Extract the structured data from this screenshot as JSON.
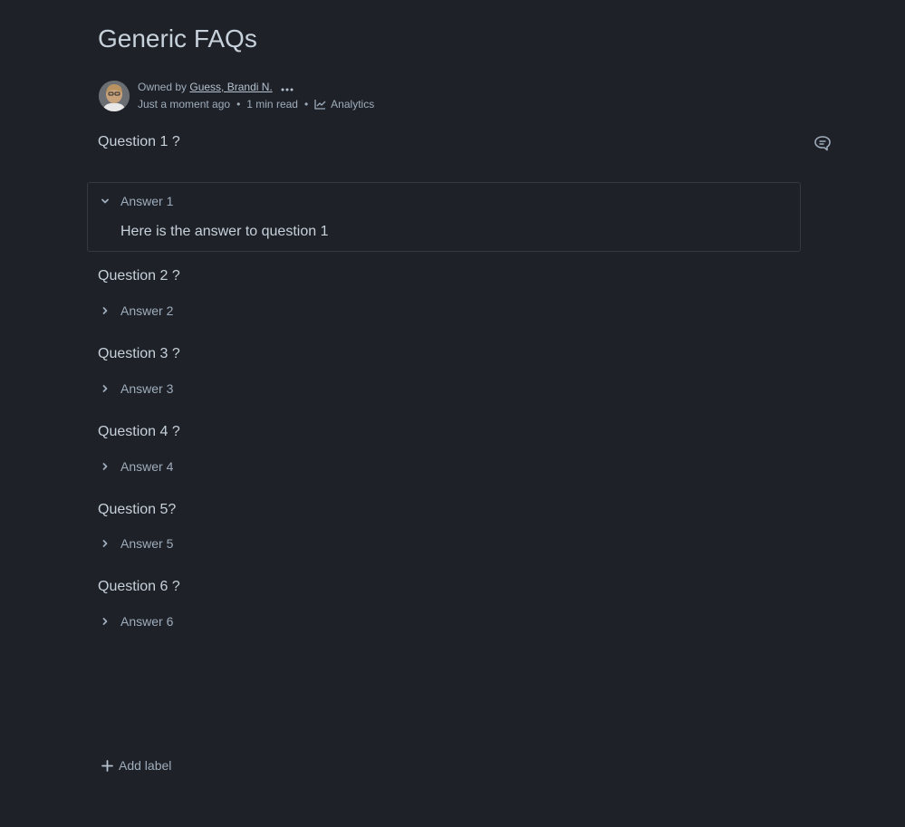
{
  "page": {
    "title": "Generic FAQs"
  },
  "byline": {
    "owned_by_prefix": "Owned by",
    "owner_name": "Guess, Brandi N.",
    "updated": "Just a moment ago",
    "read_time": "1 min read",
    "separator": "•",
    "analytics_label": "Analytics"
  },
  "faqs": [
    {
      "question": "Question 1 ?",
      "expand_title": "Answer 1",
      "expanded": true,
      "answer": "Here is the answer to question 1"
    },
    {
      "question": "Question 2 ?",
      "expand_title": "Answer 2",
      "expanded": false
    },
    {
      "question": "Question 3 ?",
      "expand_title": "Answer 3",
      "expanded": false
    },
    {
      "question": "Question 4 ?",
      "expand_title": "Answer 4",
      "expanded": false
    },
    {
      "question": "Question 5?",
      "expand_title": "Answer 5",
      "expanded": false
    },
    {
      "question": "Question 6 ?",
      "expand_title": "Answer 6",
      "expanded": false
    }
  ],
  "footer": {
    "add_label": "Add label"
  },
  "icons": {
    "more": "more-horizontal-icon",
    "analytics": "line-chart-icon",
    "comment": "comment-icon",
    "chevron_down": "chevron-down-icon",
    "chevron_right": "chevron-right-icon",
    "add": "plus-icon"
  },
  "colors": {
    "background": "#1e2127",
    "text_primary": "#c7d1db",
    "text_secondary": "#9fadbc",
    "border": "#343a42"
  }
}
